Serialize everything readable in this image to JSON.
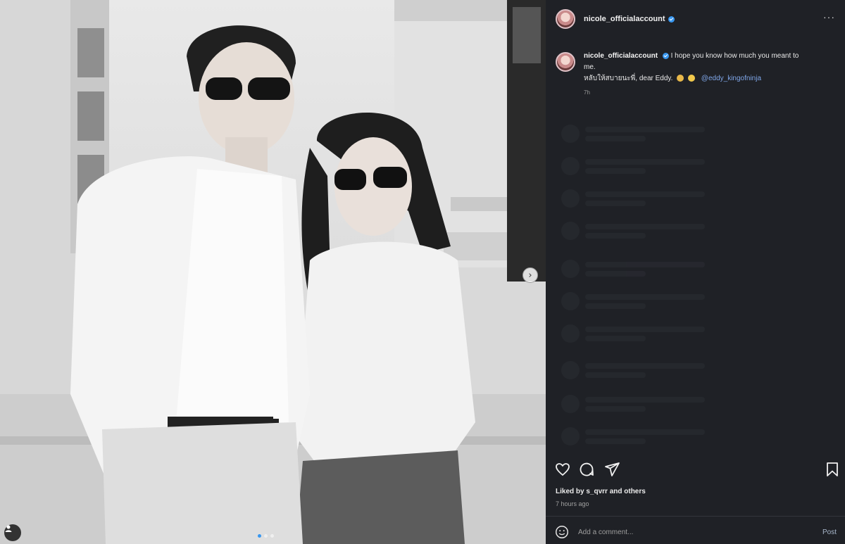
{
  "post": {
    "username": "nicole_officialaccount",
    "more_icon": "more-horizontal-icon",
    "caption_username": "nicole_officialaccount",
    "caption_line1": "I hope you know how much you meant to",
    "caption_line2": "me.",
    "caption_line3": "หลับให้สบายนะพี่, dear Eddy.",
    "mention": "@eddy_kingofninja",
    "caption_time": "7h",
    "likes_text": "Liked by s_qvrr and others",
    "time_ago": "7 hours ago",
    "comment_placeholder": "Add a comment...",
    "post_label": "Post"
  },
  "carousel": {
    "slide_count": 3,
    "active_index": 0,
    "next_icon": "chevron-right-icon"
  },
  "icons": {
    "like": "heart-icon",
    "comment": "comment-icon",
    "share": "share-icon",
    "save": "bookmark-icon",
    "emoji": "smiley-icon",
    "tag": "user-tag-icon"
  },
  "colors": {
    "panel_bg": "#1f2126",
    "verified": "#3897f0",
    "mention": "#7fa6e8"
  }
}
